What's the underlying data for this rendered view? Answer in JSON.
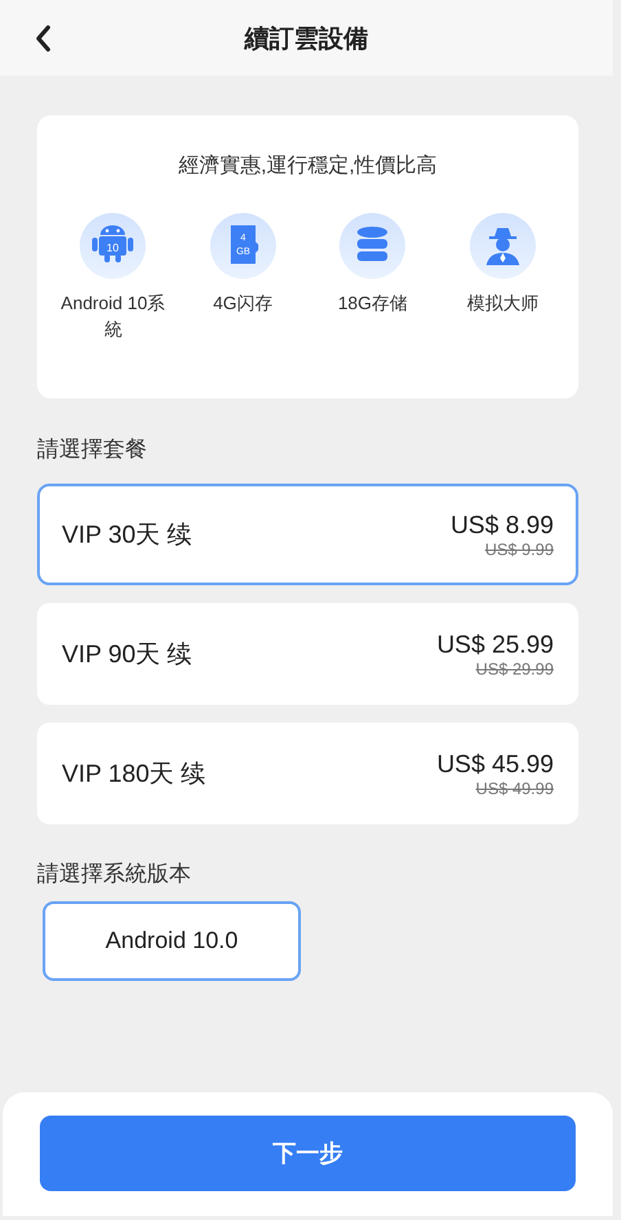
{
  "header": {
    "title": "續訂雲設備"
  },
  "features_card": {
    "headline": "經濟實惠,運行穩定,性價比高",
    "features": [
      {
        "kind": "android",
        "label": "Android 10系統",
        "icon_text": [
          "10"
        ]
      },
      {
        "kind": "sdcard",
        "label": "4G闪存",
        "icon_text": [
          "4",
          "GB"
        ]
      },
      {
        "kind": "storage",
        "label": "18G存储"
      },
      {
        "kind": "agent",
        "label": "模拟大师"
      }
    ]
  },
  "plan_section": {
    "label": "請選擇套餐",
    "plans": [
      {
        "name": "VIP 30天 续",
        "price": "US$ 8.99",
        "original_price": "US$ 9.99",
        "selected": true
      },
      {
        "name": "VIP 90天 续",
        "price": "US$ 25.99",
        "original_price": "US$ 29.99",
        "selected": false
      },
      {
        "name": "VIP 180天 续",
        "price": "US$ 45.99",
        "original_price": "US$ 49.99",
        "selected": false
      }
    ]
  },
  "version_section": {
    "label": "請選擇系統版本",
    "versions": [
      {
        "label": "Android 10.0",
        "selected": true
      }
    ]
  },
  "next_button": {
    "label": "下一步"
  }
}
